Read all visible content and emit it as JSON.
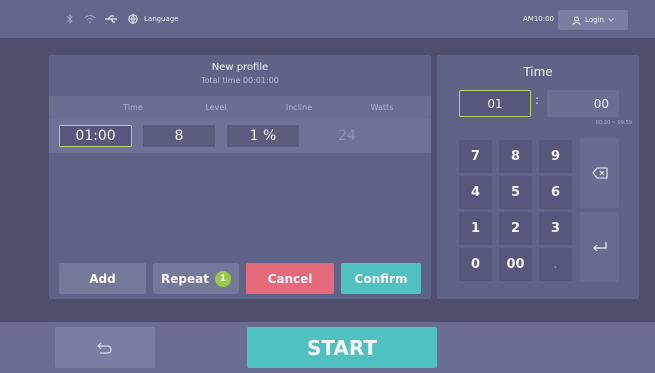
{
  "status_bar": {
    "language_label": "Language",
    "time": "AM10:00",
    "login_label": "Login"
  },
  "profile": {
    "title": "New profile",
    "subtitle": "Total time 00:01:00",
    "columns": [
      "Time",
      "Level",
      "Incline",
      "Watts"
    ],
    "row": {
      "time": "01:00",
      "level": "8",
      "incline": "1 %",
      "watts": "24"
    },
    "buttons": {
      "add": "Add",
      "repeat": "Repeat",
      "repeat_count": "1",
      "cancel": "Cancel",
      "confirm": "Confirm"
    }
  },
  "time_panel": {
    "title": "Time",
    "minutes": "01",
    "seconds": "00",
    "separator": ":",
    "range": "00:20 ~ 99:59",
    "keys": [
      "7",
      "8",
      "9",
      "4",
      "5",
      "6",
      "1",
      "2",
      "3",
      "0",
      "00",
      "."
    ]
  },
  "bottom": {
    "start_label": "START"
  },
  "colors": {
    "accent_teal": "#50c1c0",
    "cancel_red": "#e3697b",
    "active_green": "#b5d36d",
    "badge_green": "#9ac94a"
  },
  "icons": [
    "bluetooth-icon",
    "wifi-icon",
    "usb-icon",
    "globe-icon",
    "user-icon",
    "chevron-down-icon",
    "backspace-icon",
    "enter-icon",
    "back-icon"
  ]
}
